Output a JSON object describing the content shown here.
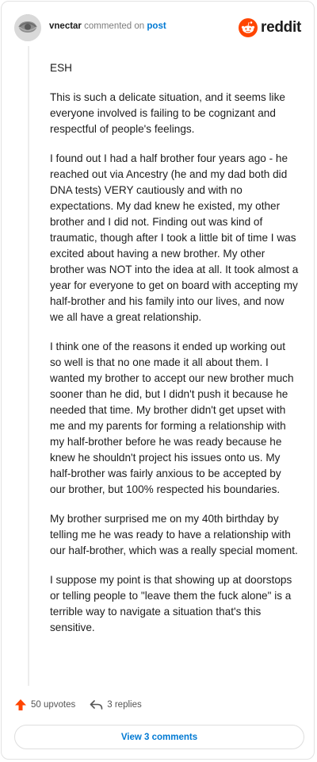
{
  "header": {
    "username": "vnectar",
    "action": "commented on",
    "post_link": "post",
    "brand": "reddit"
  },
  "comment": {
    "paragraphs": [
      "ESH",
      "This is such a delicate situation, and it seems like everyone involved is failing to be cognizant and respectful of people's feelings.",
      "I found out I had a half brother four years ago - he reached out via Ancestry (he and my dad both did DNA tests) VERY cautiously and with no expectations. My dad knew he existed, my other brother and I did not. Finding out was kind of traumatic, though after I took a little bit of time I was excited about having a new brother. My other brother was NOT into the idea at all. It took almost a year for everyone to get on board with accepting my half-brother and his family into our lives, and now we all have a great relationship.",
      "I think one of the reasons it ended up working out so well is that no one made it all about them. I wanted my brother to accept our new brother much sooner than he did, but I didn't push it because he needed that time. My brother didn't get upset with me and my parents for forming a relationship with my half-brother before he was ready because he knew he shouldn't project his issues onto us. My half-brother was fairly anxious to be accepted by our brother, but 100% respected his boundaries.",
      "My brother surprised me on my 40th birthday by telling me he was ready to have a relationship with our half-brother, which was a really special moment.",
      "I suppose my point is that showing up at doorstops or telling people to \"leave them the fuck alone\" is a terrible way to navigate a situation that's this sensitive."
    ]
  },
  "footer": {
    "upvotes": "50 upvotes",
    "replies": "3 replies",
    "view_button": "View 3 comments"
  },
  "colors": {
    "brand_orange": "#ff4500",
    "link_blue": "#0079d3"
  },
  "icons": {
    "upvote": "upvote-arrow-icon",
    "reply": "reply-arrow-icon",
    "logo": "reddit-logo-icon",
    "avatar": "user-avatar"
  }
}
